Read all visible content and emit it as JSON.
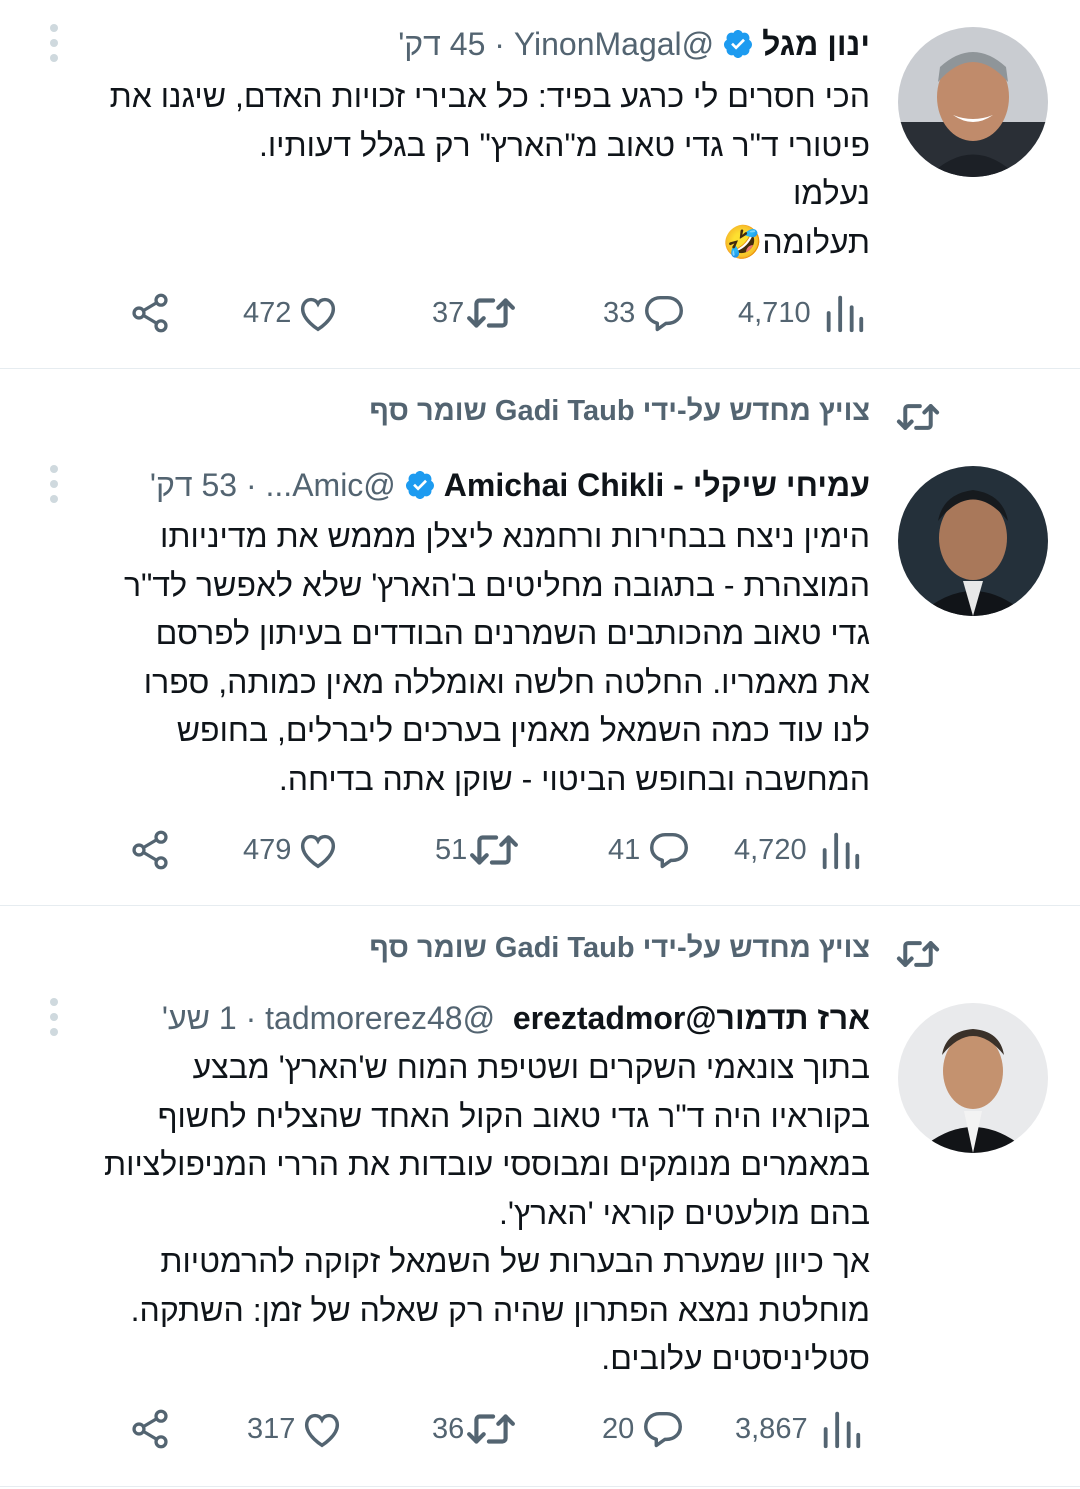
{
  "colors": {
    "text": "#0f1419",
    "muted": "#536471",
    "verified": "#1d9bf0",
    "divider": "#e6ecf0"
  },
  "tweets": [
    {
      "retweet_context": "",
      "name": "ינון מגל",
      "handle": "@YinonMagal",
      "time": "45 דק'",
      "verified": true,
      "text": "הכי חסרים לי כרגע בפיד: כל אבירי זכויות האדם, שיגנו את\nפיטורי ד\"ר גדי טאוב מ\"הארץ\" רק בגלל דעותיו.\nנעלמו\nתעלומה🤣",
      "stats": {
        "views": "4,710",
        "replies": "33",
        "retweets": "37",
        "likes": "472"
      }
    },
    {
      "retweet_context": "צויץ מחדש על-ידי Gadi Taub שומר סף",
      "name": "עמיחי שיקלי - Amichai Chikli",
      "handle": "@Amic...",
      "time": "53 דק'",
      "verified": true,
      "text": "הימין ניצח בבחירות ורחמנא ליצלן מממש את מדיניותו\nהמוצהרת - בתגובה מחליטים ב'הארץ' שלא לאפשר לד\"ר\nגדי טאוב מהכותבים  השמרנים הבודדים בעיתון לפרסם\nאת מאמריו. החלטה חלשה ואומללה מאין כמותה, ספרו\nלנו עוד כמה השמאל מאמין בערכים ליברלים, בחופש\nהמחשבה ובחופש הביטוי - שוקן אתה בדיחה.",
      "stats": {
        "views": "4,720",
        "replies": "41",
        "retweets": "51",
        "likes": "479"
      }
    },
    {
      "retweet_context": "צויץ מחדש על-ידי Gadi Taub שומר סף",
      "name": "ארז תדמור@ereztadmor",
      "handle": "@tadmorerez48",
      "time": "1 שע'",
      "verified": false,
      "text": "בתוך צונאמי השקרים ושטיפת המוח ש'הארץ' מבצע\nבקוראיו היה ד\"ר גדי טאוב הקול האחד שהצליח לחשוף\nבמאמרים מנומקים ומבוססי עובדות את הררי המניפולציות\nבהם מולעטים קוראי 'הארץ'.\nאך כיוון שמערת הבערות של השמאל זקוקה להרמטיות\nמוחלטת נמצא הפתרון שהיה רק שאלה של זמן: השתקה.\nסטליניסטים עלובים.",
      "stats": {
        "views": "3,867",
        "replies": "20",
        "retweets": "36",
        "likes": "317"
      }
    }
  ],
  "icons": [
    "more-dots-icon",
    "verified-badge-icon",
    "retweet-icon",
    "views-icon",
    "reply-icon",
    "like-icon",
    "share-icon"
  ]
}
